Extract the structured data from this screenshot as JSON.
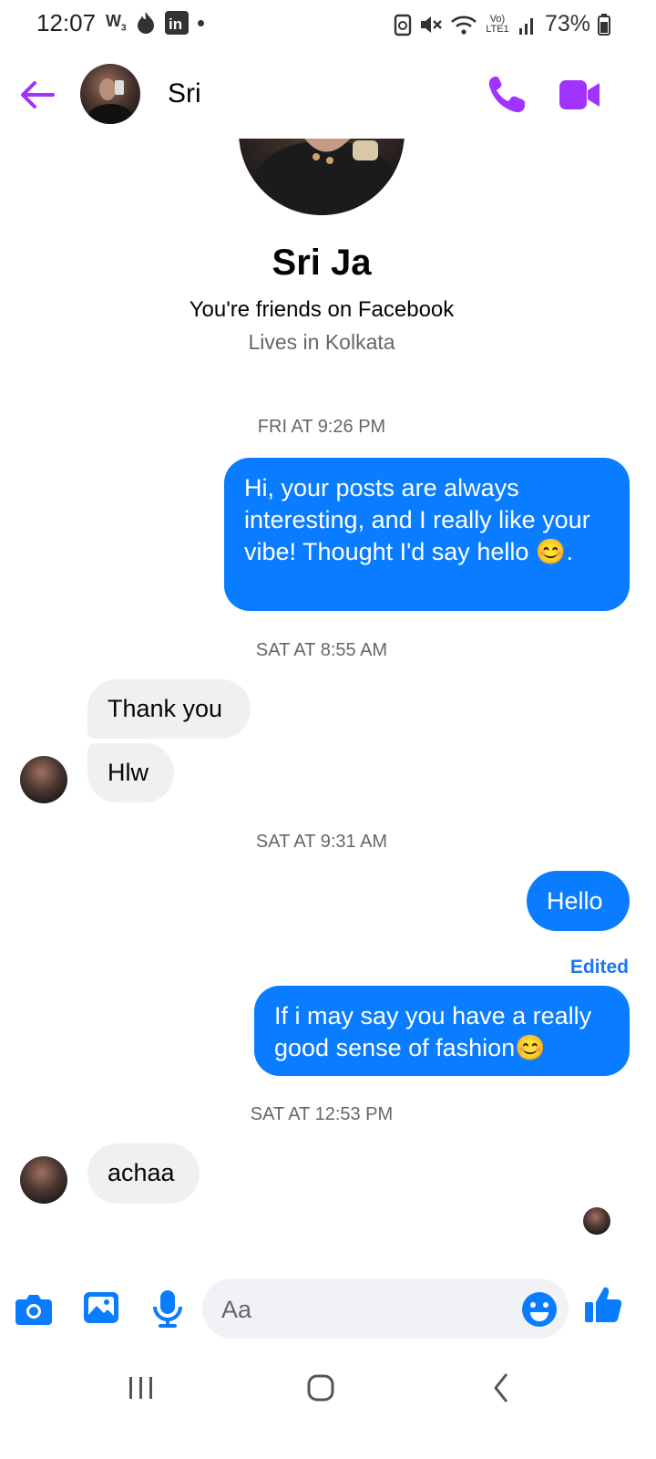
{
  "status_bar": {
    "time": "12:07",
    "battery": "73%",
    "network_label": "Vo) LTE1"
  },
  "header": {
    "contact_name": "Sri"
  },
  "profile": {
    "name": "Sri Ja",
    "relationship": "You're friends on Facebook",
    "location": "Lives in Kolkata"
  },
  "conversation": {
    "ts1": "FRI AT 9:26 PM",
    "msg1": "Hi, your posts are always interesting, and I really like your vibe! Thought I'd say hello 😊.",
    "ts2": "SAT AT 8:55 AM",
    "msg2": "Thank you",
    "msg3": "Hlw",
    "ts3": "SAT AT 9:31 AM",
    "msg4": "Hello",
    "edited_label": "Edited",
    "msg5": "If i may say you have a really good sense of fashion😊",
    "ts4": "SAT AT 12:53 PM",
    "msg6": "achaa"
  },
  "composer": {
    "placeholder": "Aa"
  },
  "colors": {
    "accent_purple": "#a033ff",
    "bubble_blue": "#0a7cff",
    "bubble_gray": "#f0f0f2",
    "icon_blue": "#0a7cff"
  },
  "icons": [
    "back-arrow-icon",
    "phone-icon",
    "video-camera-icon",
    "camera-icon",
    "gallery-icon",
    "microphone-icon",
    "emoji-icon",
    "thumbs-up-icon",
    "recents-icon",
    "home-icon",
    "nav-back-icon"
  ]
}
